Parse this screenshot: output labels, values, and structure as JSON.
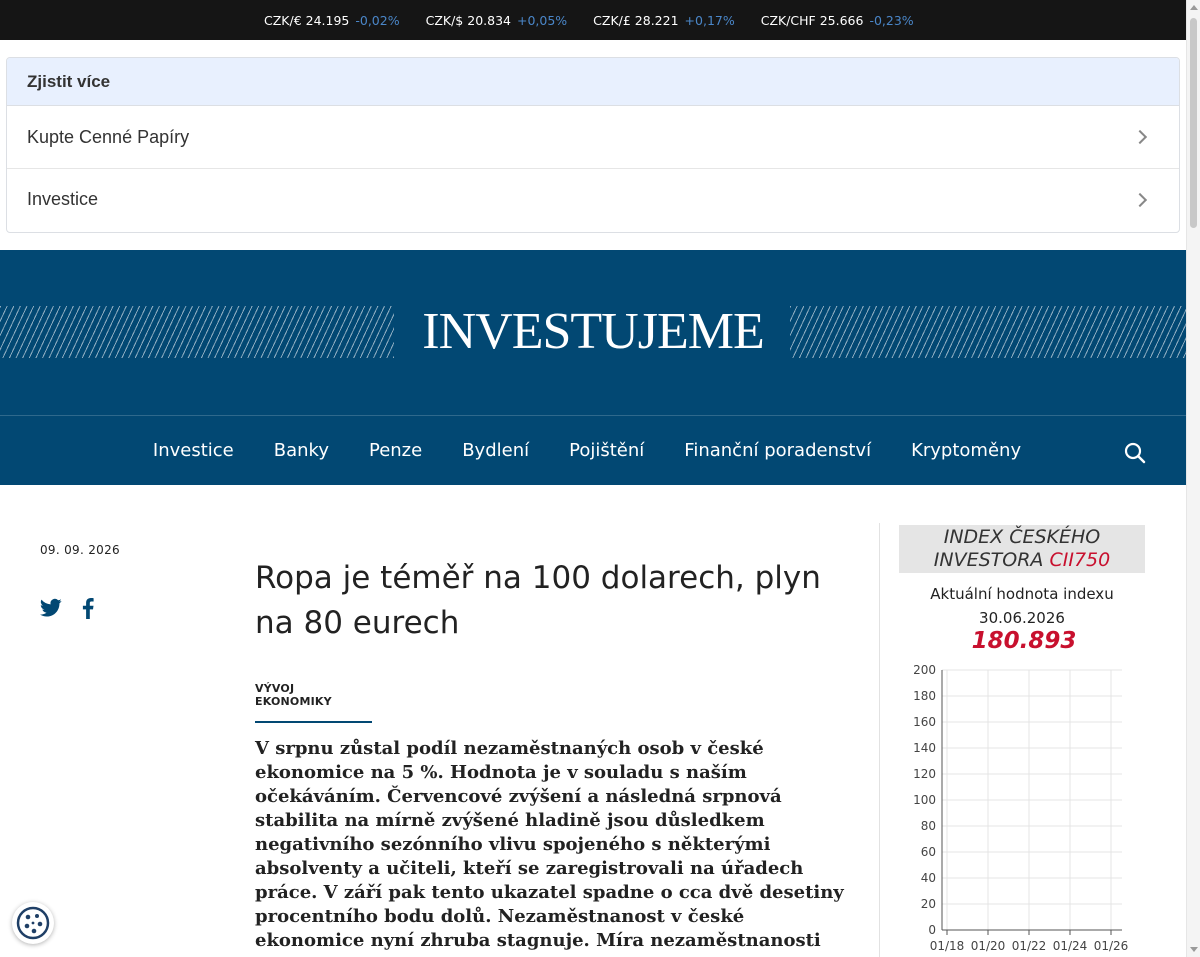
{
  "ticker": [
    {
      "label": "CZK/€ 24.195",
      "change": "-0,02%"
    },
    {
      "label": "CZK/$ 20.834",
      "change": "+0,05%"
    },
    {
      "label": "CZK/£ 28.221",
      "change": "+0,17%"
    },
    {
      "label": "CZK/CHF 25.666",
      "change": "-0,23%"
    }
  ],
  "learn_more": {
    "title": "Zjistit více",
    "items": [
      "Kupte Cenné Papíry",
      "Investice"
    ]
  },
  "header": {
    "logo": "INVESTUJEME",
    "nav": [
      "Investice",
      "Banky",
      "Penze",
      "Bydlení",
      "Pojištění",
      "Finanční poradenství",
      "Kryptoměny"
    ]
  },
  "article": {
    "date": "09. 09. 2026",
    "headline": "Ropa je téměř na 100 dolarech, plyn na 80 eurech",
    "category": "VÝVOJ EKONOMIKY",
    "lead": "V srpnu zůstal podíl nezaměstnaných osob v české ekonomice na 5 %. Hodnota je v souladu s naším očekáváním. Červencové zvýšení a následná srpnová stabilita na mírně zvýšené hladině jsou důsledkem negativního sezónního vlivu spojeného s některými absolventy a učiteli, kteří se zaregistrovali na úřadech práce. V září pak tento ukazatel spadne o cca dvě desetiny procentního bodu dolů. Nezaměstnanost v české ekonomice nyní zhruba stagnuje. Míra nezaměstnanosti"
  },
  "sidebar": {
    "index_title_1": "INDEX ČESKÉHO",
    "index_title_2": "INVESTORA ",
    "index_code": "CII750",
    "caption_1": "Aktuální hodnota indexu",
    "caption_2": "30.06.2026",
    "value": "180.893"
  },
  "colors": {
    "ticker_bg": "#151515",
    "header_bg": "#024873",
    "accent_red": "#c8102e",
    "learn_head_bg": "#e8f0fe"
  },
  "icons": [
    "chevron-right-icon",
    "search-icon",
    "twitter-icon",
    "facebook-icon",
    "cookie-icon"
  ],
  "chart_data": {
    "type": "line",
    "title": "",
    "xlabel": "",
    "ylabel": "",
    "x_ticks": [
      "01/18",
      "01/20",
      "01/22",
      "01/24",
      "01/26"
    ],
    "y_ticks": [
      0,
      20,
      40,
      60,
      80,
      100,
      120,
      140,
      160,
      180,
      200
    ],
    "ylim": [
      0,
      200
    ],
    "grid": true,
    "series": []
  }
}
